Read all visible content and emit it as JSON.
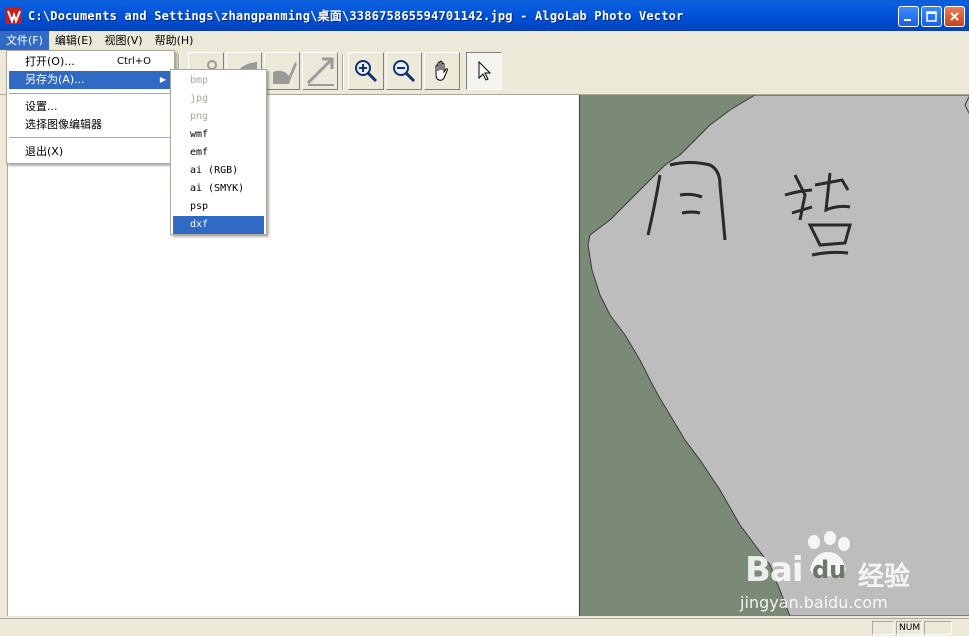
{
  "window": {
    "title": "C:\\Documents and Settings\\zhangpanming\\桌面\\338675865594701142.jpg - AlgoLab Photo Vector"
  },
  "menubar": {
    "items": [
      {
        "label": "文件(F)"
      },
      {
        "label": "编辑(E)"
      },
      {
        "label": "视图(V)"
      },
      {
        "label": "帮助(H)"
      }
    ]
  },
  "file_menu": {
    "open": {
      "label": "打开(O)...",
      "shortcut": "Ctrl+O"
    },
    "save_as": {
      "label": "另存为(A)..."
    },
    "settings": {
      "label": "设置..."
    },
    "choose_editor": {
      "label": "选择图像编辑器"
    },
    "exit": {
      "label": "退出(X)"
    }
  },
  "save_as_submenu": {
    "items": [
      {
        "label": "bmp",
        "enabled": false
      },
      {
        "label": "jpg",
        "enabled": false
      },
      {
        "label": "png",
        "enabled": false
      },
      {
        "label": "wmf",
        "enabled": true
      },
      {
        "label": "emf",
        "enabled": true
      },
      {
        "label": "ai (RGB)",
        "enabled": true
      },
      {
        "label": "ai (SMYK)",
        "enabled": true
      },
      {
        "label": "psp",
        "enabled": true
      },
      {
        "label": "dxf",
        "enabled": true,
        "highlighted": true
      }
    ]
  },
  "toolbar": {
    "icons": [
      "scissors-icon",
      "fill-icon",
      "brush-icon",
      "diagonal-tool-icon",
      "zoom-in-icon",
      "zoom-out-icon",
      "hand-icon",
      "pointer-icon"
    ]
  },
  "statusbar": {
    "num": "NUM"
  },
  "watermark": {
    "main": "Bai",
    "logo_text": "du",
    "brand": "经验",
    "url": "jingyan.baidu.com"
  },
  "colors": {
    "titlebar": "#0a5fd8",
    "highlight": "#316ac5",
    "canvas_bg": "#7a8a76",
    "paper": "#bdbdbd",
    "chrome": "#ece9d8"
  }
}
